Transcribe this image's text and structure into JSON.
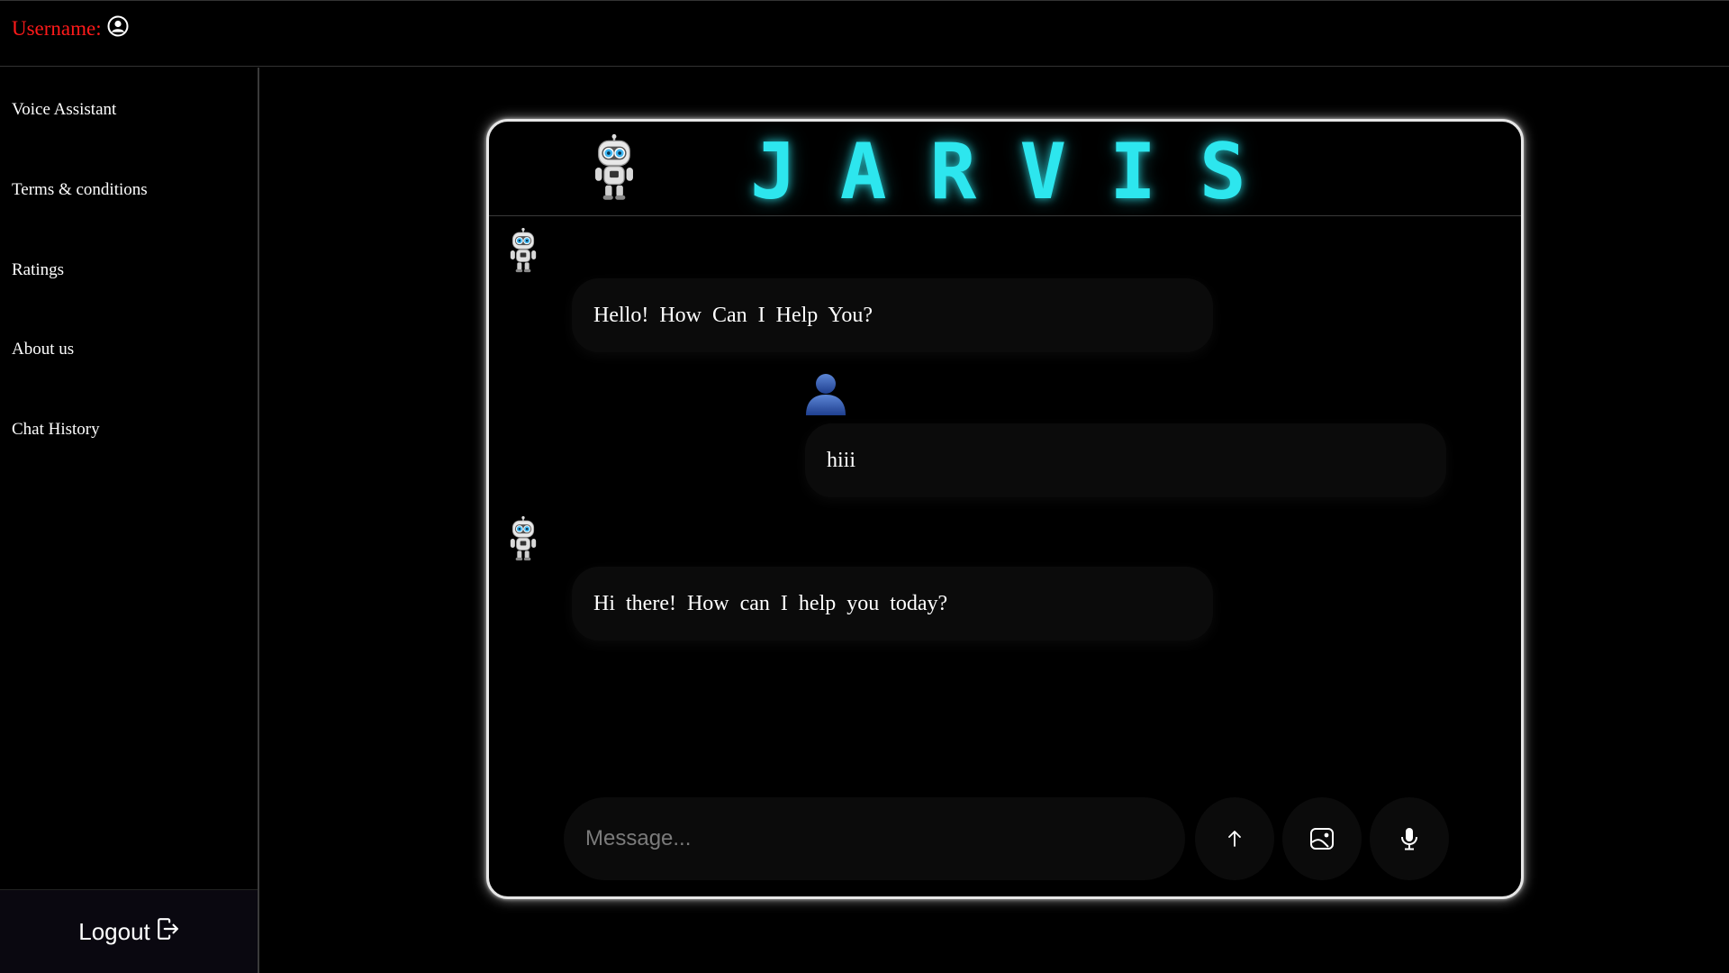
{
  "header": {
    "username_label": "Username:"
  },
  "sidebar": {
    "items": [
      {
        "label": "Voice Assistant"
      },
      {
        "label": "Terms & conditions"
      },
      {
        "label": "Ratings"
      },
      {
        "label": "About us"
      },
      {
        "label": "Chat History"
      }
    ],
    "logout_label": "Logout"
  },
  "chat": {
    "title": "JARVIS",
    "messages": [
      {
        "sender": "bot",
        "text": "Hello!  How  Can  I  Help  You?"
      },
      {
        "sender": "user",
        "text": "hiii"
      },
      {
        "sender": "bot",
        "text": "Hi  there!  How  can  I  help  you  today?"
      }
    ],
    "input": {
      "placeholder": "Message..."
    },
    "buttons": {
      "send_icon": "arrow-up-icon",
      "image_icon": "image-icon",
      "mic_icon": "microphone-icon"
    }
  },
  "colors": {
    "accent": "#2de6ee",
    "username": "#ff1a1a",
    "bubble": "#0b0b0b"
  }
}
